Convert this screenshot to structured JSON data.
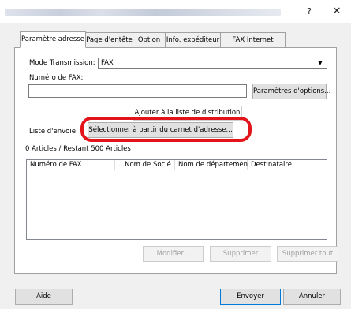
{
  "window": {
    "help_glyph": "?",
    "close_glyph": "✕"
  },
  "tabs": [
    {
      "label": "Paramètre adresse",
      "active": true
    },
    {
      "label": "Page d'entête",
      "active": false
    },
    {
      "label": "Option",
      "active": false
    },
    {
      "label": "Info. expéditeur",
      "active": false
    },
    {
      "label": "FAX Internet",
      "active": false
    }
  ],
  "address": {
    "mode_label": "Mode Transmission:",
    "mode_value": "FAX",
    "mode_arrow": "▼",
    "fax_number_label": "Numéro de FAX:",
    "fax_number_value": "",
    "options_button": "Paramètres d'options...",
    "add_to_list_button": "Ajouter à la liste de distribution",
    "send_list_label": "Liste d'envoie:",
    "addressbook_button": "Sélectionner à partir du carnet d'adresse...",
    "counter": "0 Articles / Restant 500 Articles"
  },
  "list": {
    "columns": [
      "Numéro de FAX",
      "...Nom de Socié",
      "Nom de département",
      "Destinataire"
    ],
    "rows": []
  },
  "list_buttons": {
    "modify": "Modifier...",
    "delete": "Supprimer",
    "delete_all": "Supprimer tout"
  },
  "footer": {
    "help": "Aide",
    "send": "Envoyer",
    "cancel": "Annuler"
  },
  "colors": {
    "highlight": "#e3131a",
    "dialog_bg": "#f0f0f0",
    "default_button_border": "#0078d7"
  }
}
